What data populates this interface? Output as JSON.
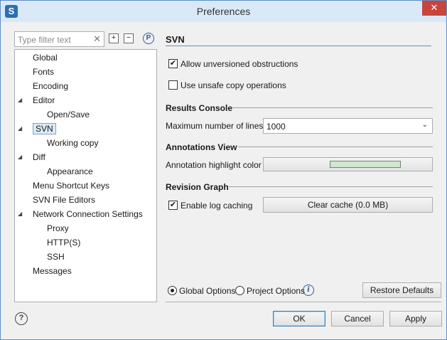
{
  "window": {
    "title": "Preferences",
    "app_icon": "S",
    "close_glyph": "✕"
  },
  "left": {
    "filter_placeholder": "Type filter text",
    "filter_clear": "✕",
    "tree": [
      {
        "label": "Global",
        "level": 0,
        "arrow": ""
      },
      {
        "label": "Fonts",
        "level": 0,
        "arrow": ""
      },
      {
        "label": "Encoding",
        "level": 0,
        "arrow": ""
      },
      {
        "label": "Editor",
        "level": 0,
        "arrow": "◢"
      },
      {
        "label": "Open/Save",
        "level": 1,
        "arrow": ""
      },
      {
        "label": "SVN",
        "level": 0,
        "arrow": "◢",
        "selected": true
      },
      {
        "label": "Working copy",
        "level": 1,
        "arrow": ""
      },
      {
        "label": "Diff",
        "level": 0,
        "arrow": "◢"
      },
      {
        "label": "Appearance",
        "level": 1,
        "arrow": ""
      },
      {
        "label": "Menu Shortcut Keys",
        "level": 0,
        "arrow": ""
      },
      {
        "label": "SVN File Editors",
        "level": 0,
        "arrow": ""
      },
      {
        "label": "Network Connection Settings",
        "level": 0,
        "arrow": "◢"
      },
      {
        "label": "Proxy",
        "level": 1,
        "arrow": ""
      },
      {
        "label": "HTTP(S)",
        "level": 1,
        "arrow": ""
      },
      {
        "label": "SSH",
        "level": 1,
        "arrow": ""
      },
      {
        "label": "Messages",
        "level": 0,
        "arrow": ""
      }
    ]
  },
  "main": {
    "page_title": "SVN",
    "allow_unversioned": {
      "label": "Allow unversioned obstructions",
      "checked": true
    },
    "unsafe_copy": {
      "label": "Use unsafe copy operations",
      "checked": false
    },
    "results_console": {
      "heading": "Results Console",
      "max_lines_label": "Maximum number of lines",
      "max_lines_value": "1000"
    },
    "annotations_view": {
      "heading": "Annotations View",
      "highlight_label": "Annotation highlight color",
      "highlight_color": "#cfe8cf"
    },
    "revision_graph": {
      "heading": "Revision Graph",
      "enable_caching": {
        "label": "Enable log caching",
        "checked": true
      },
      "clear_cache_label": "Clear cache (0.0 MB)"
    },
    "options": {
      "global_label": "Global Options",
      "project_label": "Project Options",
      "selected": "global"
    },
    "restore_defaults_label": "Restore Defaults"
  },
  "footer": {
    "ok_label": "OK",
    "cancel_label": "Cancel",
    "apply_label": "Apply"
  },
  "icons": {
    "p_icon": "P",
    "info_icon": "i",
    "help_icon": "?",
    "check": "✔",
    "dropdown": "⌄"
  }
}
